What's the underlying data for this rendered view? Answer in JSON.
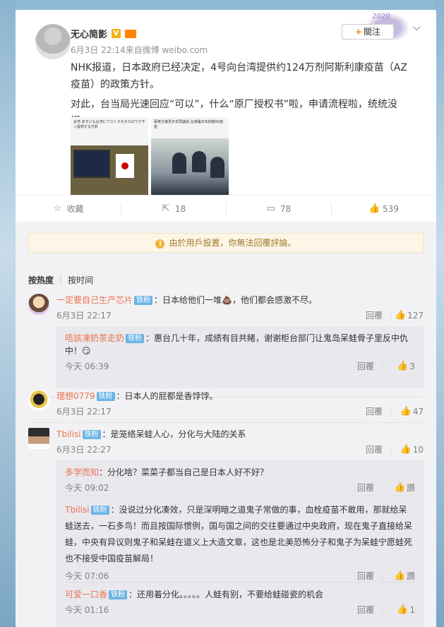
{
  "post": {
    "author": "无心简影",
    "meta": "6月3日 22:14来自微博 weibo.com",
    "follow_label": "關注",
    "deco_text": "2020",
    "paragraphs": [
      "NHK报道，日本政府已经决定，4号向台湾提供约124万剂阿斯利康疫苗（AZ疫苗）的政策方针。",
      "对此，台当局光速回应“可以”，什么“原厂授权书”啦，申请流程啦，统统没提。"
    ],
    "thumb1_caption": "台湾 あすにも台湾にアストラゼネカのワクチン提供する方針",
    "thumb2_caption": "蔡英文接見日本眾議員 台灣獲日本捐贈AZ疫苗",
    "actions": {
      "collect": "收藏",
      "share": "18",
      "comment": "78",
      "like": "539"
    }
  },
  "comments_section": {
    "notice": "由於用戶設置，你無法回覆評論。",
    "sort_hot": "按热度",
    "sort_time": "按时间",
    "reply_label": "回覆",
    "tiefen": "铁粉",
    "items": [
      {
        "nick": "一定要自己生产芯片",
        "text": "：日本给他们一堆💩，他们都会感激不尽。",
        "time": "6月3日 22:17",
        "likes": "127",
        "replies": [
          {
            "nick": "唔該凍奶茶走奶",
            "text": "：惠台几十年，成绩有目共睹，谢谢柜台部门让鬼岛呆蛙骨子里反中仇中！😏",
            "time": "今天 06:39",
            "likes": "3"
          }
        ]
      },
      {
        "nick": "理想0779",
        "text": "：日本人的屁都是香饽饽。",
        "time": "6月3日 22:17",
        "likes": "47",
        "replies": []
      },
      {
        "nick": "Tbilisi",
        "text": "：是笼络呆蛙人心，分化与大陆的关系",
        "time": "6月3日 22:27",
        "likes": "10",
        "replies": [
          {
            "nick": "多学而知",
            "text": "：分化啥？菜菜子都当自己是日本人好不好？",
            "time": "今天 09:02",
            "likes": "讚"
          },
          {
            "nick": "Tbilisi",
            "text": "：没说过分化凑效，只是深明暗之道鬼子常做的事，血栓疫苗不敢用，那就给呆蛙送去，一石多鸟！而且按国际惯例，国与国之间的交往要通过中央政府，现在鬼子直接给呆蛙，中央有异议则鬼子和呆蛙在道义上大造文章，这也是北美恐怖分子和鬼子为呆蛙宁愿蛙死也不接受中国疫苗解局！",
            "time": "今天 07:06",
            "likes": "讚"
          },
          {
            "nick": "可爱一口香",
            "text": "：还用着分化。。。。。人蛙有别，不要给蛙碰瓷的机会",
            "time": "今天 01:16",
            "likes": "1"
          }
        ]
      }
    ]
  }
}
